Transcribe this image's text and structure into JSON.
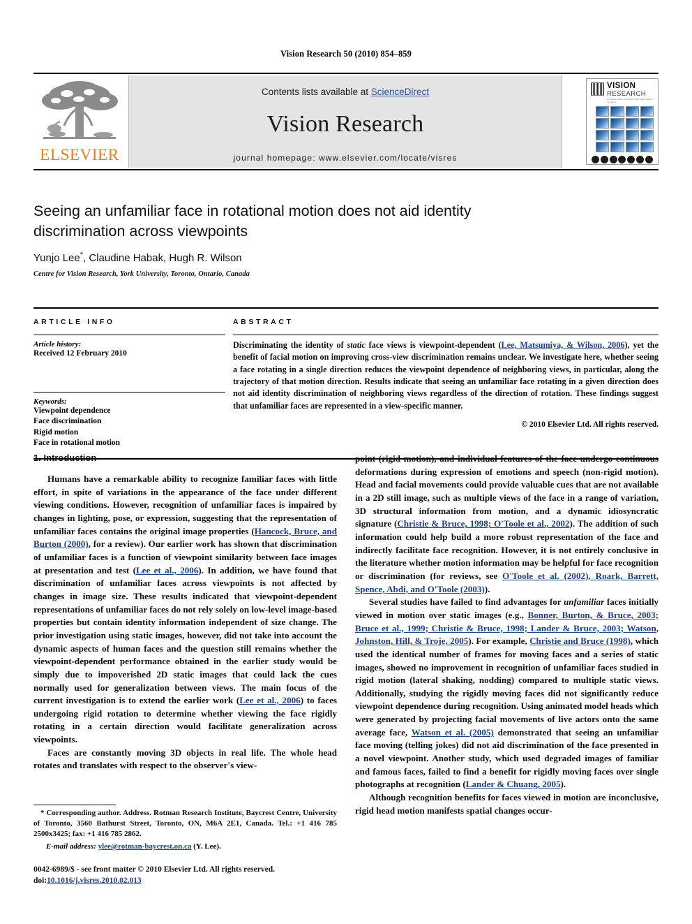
{
  "running_head": "Vision Research 50 (2010) 854–859",
  "masthead": {
    "contents_prefix": "Contents lists available at ",
    "sciencedirect": "ScienceDirect",
    "journal_name": "Vision Research",
    "homepage": "journal homepage: www.elsevier.com/locate/visres",
    "publisher_wordmark": "ELSEVIER",
    "cover": {
      "title_line1": "VISION",
      "title_line2": "RESEARCH",
      "subtitle": "An International Journal for Functional Aspects of Vision"
    }
  },
  "title_block": {
    "title": "Seeing an unfamiliar face in rotational motion does not aid identity discrimination across viewpoints",
    "authors": "Yunjo Lee",
    "authors_rest": ", Claudine Habak, Hugh R. Wilson",
    "corresponding_marker": "*",
    "affiliation": "Centre for Vision Research, York University, Toronto, Ontario, Canada"
  },
  "article_info": {
    "heading": "ARTICLE INFO",
    "history_label": "Article history:",
    "history_received": "Received 12 February 2010",
    "keywords_label": "Keywords:",
    "keywords": [
      "Viewpoint dependence",
      "Face discrimination",
      "Rigid motion",
      "Face in rotational motion"
    ]
  },
  "abstract": {
    "heading": "ABSTRACT",
    "p1_a": "Discriminating the identity of ",
    "p1_italic": "static",
    "p1_b": " face views is viewpoint-dependent (",
    "p1_ref": "Lee, Matsumiya, & Wilson, 2006",
    "p1_c": "), yet the benefit of facial motion on improving cross-view discrimination remains unclear. We investigate here, whether seeing a face rotating in a single direction reduces the viewpoint dependence of neighboring views, in particular, along the trajectory of that motion direction. Results indicate that seeing an unfamiliar face rotating in a given direction does not aid identity discrimination of neighboring views regardless of the direction of rotation. These findings suggest that unfamiliar faces are represented in a view-specific manner.",
    "copyright": "© 2010 Elsevier Ltd. All rights reserved."
  },
  "body": {
    "section_heading": "1. Introduction",
    "left_col": {
      "p1_a": "Humans have a remarkable ability to recognize familiar faces with little effort, in spite of variations in the appearance of the face under different viewing conditions. However, recognition of unfamiliar faces is impaired by changes in lighting, pose, or expression, suggesting that the representation of unfamiliar faces contains the original image properties (",
      "p1_ref1": "Hancock, Bruce, and Burton (2000)",
      "p1_b": ", for a review). Our earlier work has shown that discrimination of unfamiliar faces is a function of viewpoint similarity between face images at presentation and test (",
      "p1_ref2": "Lee et al., 2006",
      "p1_c": "). In addition, we have found that discrimination of unfamiliar faces across viewpoints is not affected by changes in image size. These results indicated that viewpoint-dependent representations of unfamiliar faces do not rely solely on low-level image-based properties but contain identity information independent of size change. The prior investigation using static images, however, did not take into account the dynamic aspects of human faces and the question still remains whether the viewpoint-dependent performance obtained in the earlier study would be simply due to impoverished 2D static images that could lack the cues normally used for generalization between views. The main focus of the current investigation is to extend the earlier work (",
      "p1_ref3": "Lee et al., 2006",
      "p1_d": ") to faces undergoing rigid rotation to determine whether viewing the face rigidly rotating in a certain direction would facilitate generalization across viewpoints.",
      "p2": "Faces are constantly moving 3D objects in real life. The whole head rotates and translates with respect to the observer's view-"
    },
    "right_col": {
      "p1_a": "point (rigid motion), and individual features of the face undergo continuous deformations during expression of emotions and speech (non-rigid motion). Head and facial movements could provide valuable cues that are not available in a 2D still image, such as multiple views of the face in a range of variation, 3D structural information from motion, and a dynamic idiosyncratic signature (",
      "p1_ref1": "Christie & Bruce, 1998; O'Toole et al., 2002",
      "p1_b": "). The addition of such information could help build a more robust representation of the face and indirectly facilitate face recognition. However, it is not entirely conclusive in the literature whether motion information may be helpful for face recognition or discrimination (for reviews, see ",
      "p1_ref2": "O'Toole et al. (2002), Roark, Barrett, Spence, Abdi, and O'Toole (2003)",
      "p1_c": ").",
      "p2_a": "Several studies have failed to find advantages for ",
      "p2_italic": "unfamiliar",
      "p2_b": " faces initially viewed in motion over static images (e.g., ",
      "p2_ref1": "Bonner, Burton, & Bruce, 2003; Bruce et al., 1999; Christie & Bruce, 1998; Lander & Bruce, 2003; Watson, Johnston, Hill, & Troje, 2005",
      "p2_c": "). For example, ",
      "p2_ref2": "Christie and Bruce (1998)",
      "p2_d": ", which used the identical number of frames for moving faces and a series of static images, showed no improvement in recognition of unfamiliar faces studied in rigid motion (lateral shaking, nodding) compared to multiple static views. Additionally, studying the rigidly moving faces did not significantly reduce viewpoint dependence during recognition. Using animated model heads which were generated by projecting facial movements of live actors onto the same average face, ",
      "p2_ref3": "Watson et al. (2005)",
      "p2_e": " demonstrated that seeing an unfamiliar face moving (telling jokes) did not aid discrimination of the face presented in a novel viewpoint. Another study, which used degraded images of familiar and famous faces, failed to find a benefit for rigidly moving faces over single photographs at recognition (",
      "p2_ref4": "Lander & Chuang, 2005",
      "p2_f": ").",
      "p3": "Although recognition benefits for faces viewed in motion are inconclusive, rigid head motion manifests spatial changes occur-"
    }
  },
  "footnote": {
    "text": "* Corresponding author. Address. Rotman Research Institute, Baycrest Centre, University of Toronto, 3560 Bathurst Street, Toronto, ON, M6A 2E1, Canada. Tel.: +1 416 785 2500x3425; fax: +1 416 785 2862.",
    "email_label": "E-mail address:",
    "email": "ylee@rotman-baycrest.on.ca",
    "email_suffix": "(Y. Lee)."
  },
  "imprint": {
    "line1": "0042-6989/$ - see front matter © 2010 Elsevier Ltd. All rights reserved.",
    "doi_label": "doi:",
    "doi": "10.1016/j.visres.2010.02.013"
  },
  "colors": {
    "link": "#1c3f87",
    "sciencedirect": "#2b4ea2",
    "elsevier_orange": "#ef7d10",
    "masthead_bg": "#e4e4e4"
  }
}
